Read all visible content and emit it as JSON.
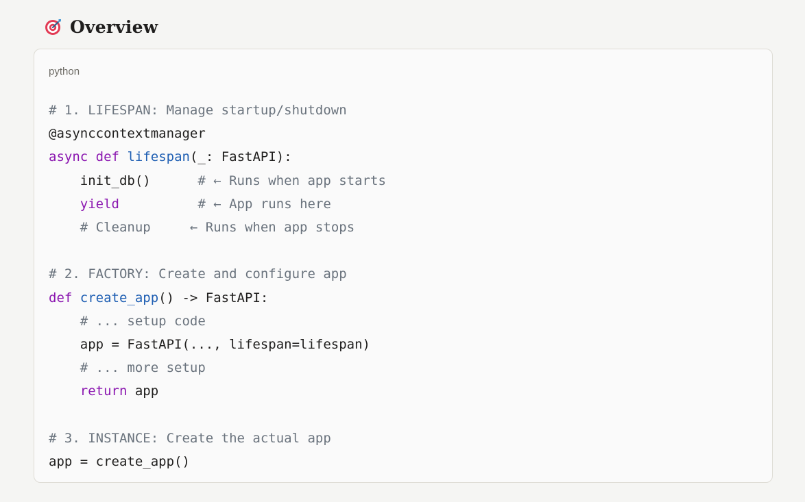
{
  "heading": {
    "icon": "direct-hit-target-icon",
    "title": "Overview"
  },
  "code_block": {
    "language": "python",
    "lines": [
      [
        {
          "t": "comment",
          "v": "# 1. LIFESPAN: Manage startup/shutdown"
        }
      ],
      [
        {
          "t": "plain",
          "v": "@asynccontextmanager"
        }
      ],
      [
        {
          "t": "keyword",
          "v": "async"
        },
        {
          "t": "plain",
          "v": " "
        },
        {
          "t": "keyword",
          "v": "def"
        },
        {
          "t": "plain",
          "v": " "
        },
        {
          "t": "fn",
          "v": "lifespan"
        },
        {
          "t": "plain",
          "v": "(_: FastAPI):"
        }
      ],
      [
        {
          "t": "plain",
          "v": "    init_db()      "
        },
        {
          "t": "comment",
          "v": "# ← Runs when app starts"
        }
      ],
      [
        {
          "t": "plain",
          "v": "    "
        },
        {
          "t": "keyword",
          "v": "yield"
        },
        {
          "t": "plain",
          "v": "          "
        },
        {
          "t": "comment",
          "v": "# ← App runs here"
        }
      ],
      [
        {
          "t": "plain",
          "v": "    "
        },
        {
          "t": "comment",
          "v": "# Cleanup     ← Runs when app stops"
        }
      ],
      [
        {
          "t": "plain",
          "v": ""
        }
      ],
      [
        {
          "t": "comment",
          "v": "# 2. FACTORY: Create and configure app"
        }
      ],
      [
        {
          "t": "keyword",
          "v": "def"
        },
        {
          "t": "plain",
          "v": " "
        },
        {
          "t": "fn",
          "v": "create_app"
        },
        {
          "t": "plain",
          "v": "() -> FastAPI:"
        }
      ],
      [
        {
          "t": "plain",
          "v": "    "
        },
        {
          "t": "comment",
          "v": "# ... setup code"
        }
      ],
      [
        {
          "t": "plain",
          "v": "    app = FastAPI(..., lifespan=lifespan)"
        }
      ],
      [
        {
          "t": "plain",
          "v": "    "
        },
        {
          "t": "comment",
          "v": "# ... more setup"
        }
      ],
      [
        {
          "t": "plain",
          "v": "    "
        },
        {
          "t": "keyword",
          "v": "return"
        },
        {
          "t": "plain",
          "v": " app"
        }
      ],
      [
        {
          "t": "plain",
          "v": ""
        }
      ],
      [
        {
          "t": "comment",
          "v": "# 3. INSTANCE: Create the actual app"
        }
      ],
      [
        {
          "t": "plain",
          "v": "app = create_app()"
        }
      ]
    ]
  },
  "colors": {
    "comment": "#6a737d",
    "keyword": "#8b17b0",
    "function": "#1f5fb3",
    "text": "#1f1e1d",
    "card_background": "#fafafa",
    "page_background": "#f5f5f3"
  }
}
